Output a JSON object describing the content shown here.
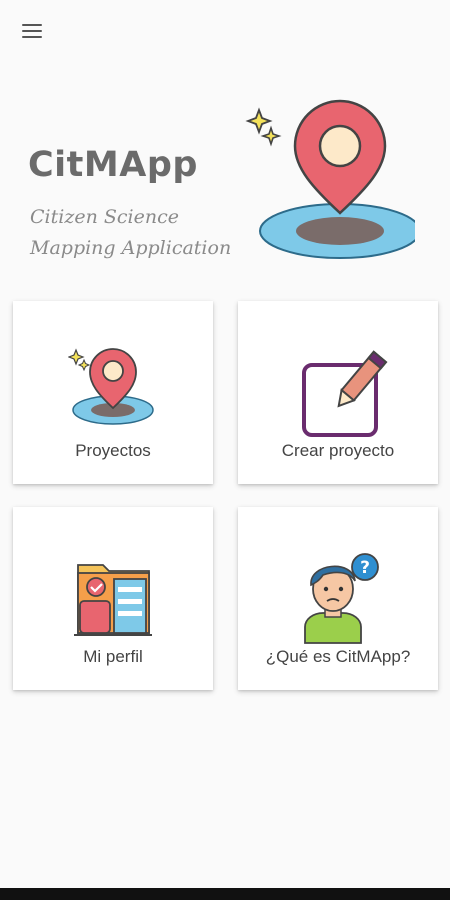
{
  "header": {
    "menu_icon": "hamburger-menu-icon"
  },
  "hero": {
    "title": "CitMApp",
    "subtitle_line1": "Citizen Science",
    "subtitle_line2": "Mapping Application",
    "illustration": "map-pin-icon"
  },
  "cards": {
    "projects": {
      "label": "Proyectos",
      "icon": "map-pin-icon"
    },
    "create": {
      "label": "Crear proyecto",
      "icon": "edit-note-icon"
    },
    "profile": {
      "label": "Mi perfil",
      "icon": "profile-folder-icon"
    },
    "about": {
      "label": "¿Qué es CitMApp?",
      "icon": "confused-person-icon"
    }
  },
  "colors": {
    "background": "#fafafa",
    "pin_red": "#e8656f",
    "pin_face": "#fde9c9",
    "pin_base_blue": "#7ec9e8",
    "pencil_purple": "#6a2c6e",
    "text_gray": "#6b6b6b"
  }
}
